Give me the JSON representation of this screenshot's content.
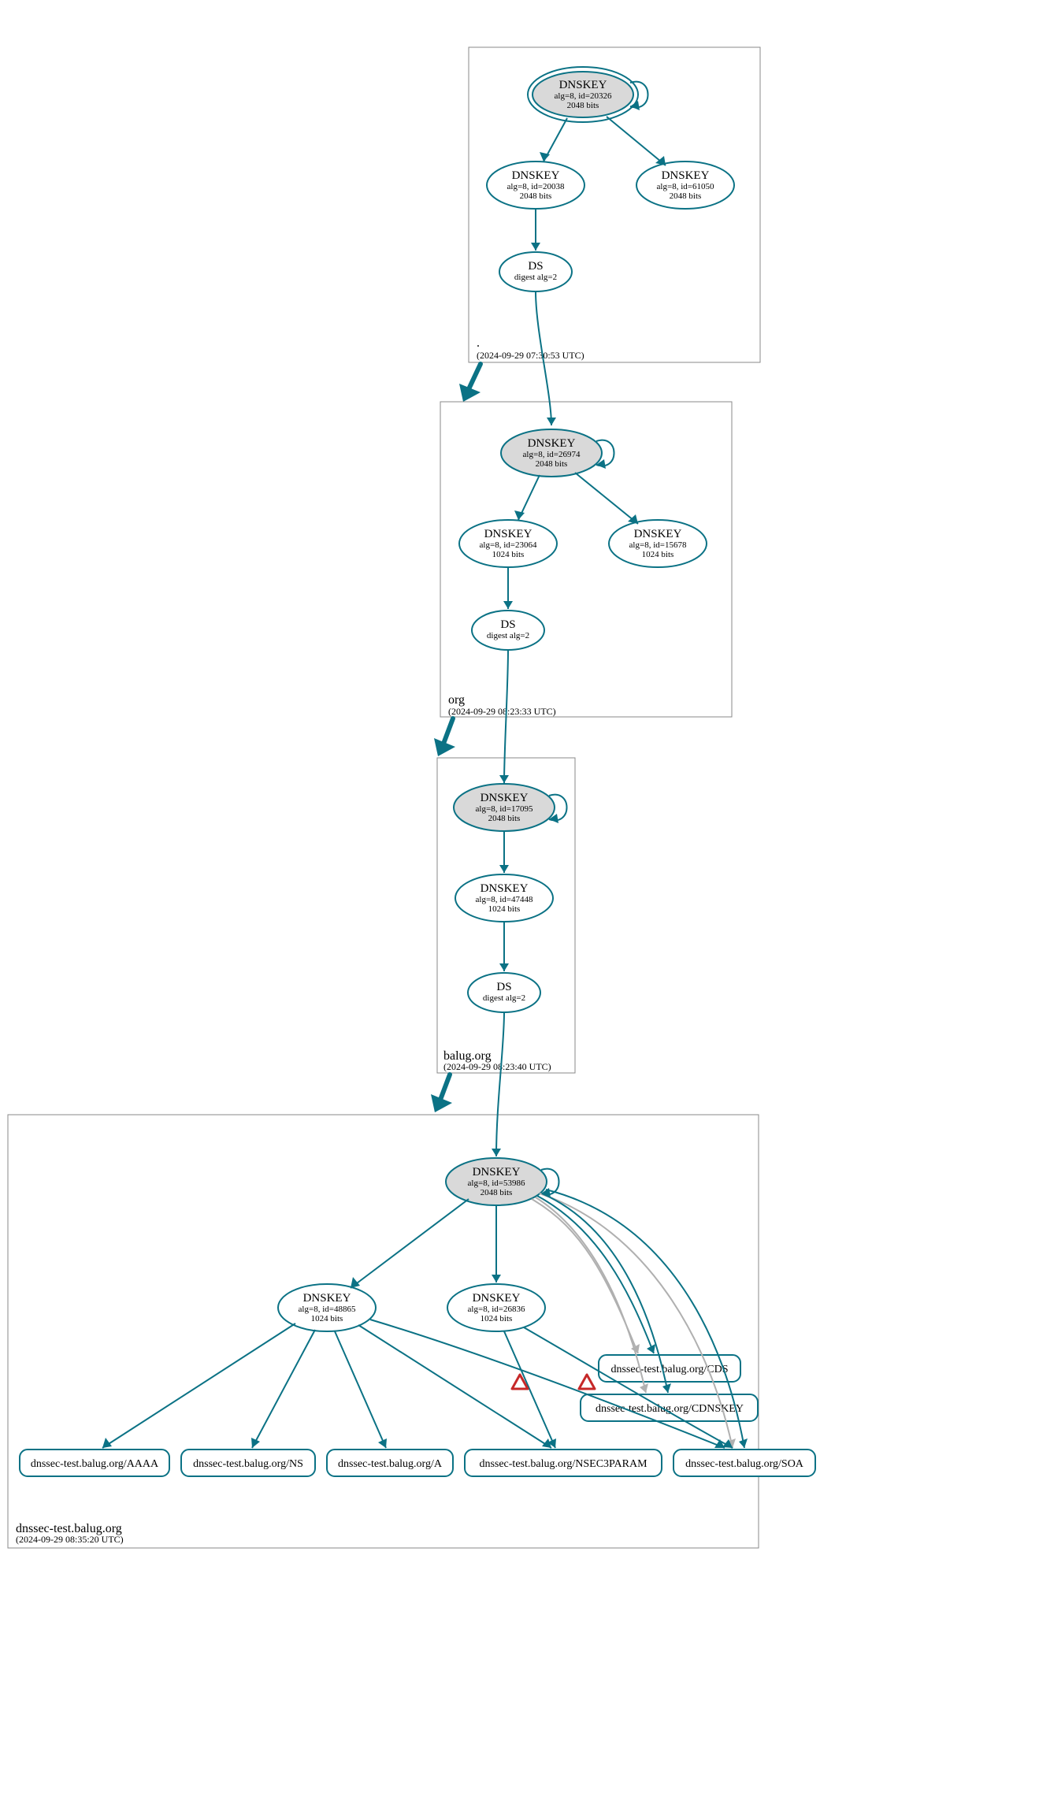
{
  "zones": {
    "root": {
      "label": ".",
      "timestamp": "(2024-09-29 07:30:53 UTC)"
    },
    "org": {
      "label": "org",
      "timestamp": "(2024-09-29 08:23:33 UTC)"
    },
    "balug": {
      "label": "balug.org",
      "timestamp": "(2024-09-29 08:23:40 UTC)"
    },
    "dnssec": {
      "label": "dnssec-test.balug.org",
      "timestamp": "(2024-09-29 08:35:20 UTC)"
    }
  },
  "nodes": {
    "root_ksk": {
      "title": "DNSKEY",
      "line2": "alg=8, id=20326",
      "line3": "2048 bits"
    },
    "root_zsk1": {
      "title": "DNSKEY",
      "line2": "alg=8, id=20038",
      "line3": "2048 bits"
    },
    "root_zsk2": {
      "title": "DNSKEY",
      "line2": "alg=8, id=61050",
      "line3": "2048 bits"
    },
    "root_ds": {
      "title": "DS",
      "line2": "digest alg=2"
    },
    "org_ksk": {
      "title": "DNSKEY",
      "line2": "alg=8, id=26974",
      "line3": "2048 bits"
    },
    "org_zsk1": {
      "title": "DNSKEY",
      "line2": "alg=8, id=23064",
      "line3": "1024 bits"
    },
    "org_zsk2": {
      "title": "DNSKEY",
      "line2": "alg=8, id=15678",
      "line3": "1024 bits"
    },
    "org_ds": {
      "title": "DS",
      "line2": "digest alg=2"
    },
    "balug_ksk": {
      "title": "DNSKEY",
      "line2": "alg=8, id=17095",
      "line3": "2048 bits"
    },
    "balug_zsk": {
      "title": "DNSKEY",
      "line2": "alg=8, id=47448",
      "line3": "1024 bits"
    },
    "balug_ds": {
      "title": "DS",
      "line2": "digest alg=2"
    },
    "dnssec_ksk": {
      "title": "DNSKEY",
      "line2": "alg=8, id=53986",
      "line3": "2048 bits"
    },
    "dnssec_zsk1": {
      "title": "DNSKEY",
      "line2": "alg=8, id=48865",
      "line3": "1024 bits"
    },
    "dnssec_zsk2": {
      "title": "DNSKEY",
      "line2": "alg=8, id=26836",
      "line3": "1024 bits"
    }
  },
  "rr": {
    "aaaa": "dnssec-test.balug.org/AAAA",
    "ns": "dnssec-test.balug.org/NS",
    "a": "dnssec-test.balug.org/A",
    "nsec3": "dnssec-test.balug.org/NSEC3PARAM",
    "soa": "dnssec-test.balug.org/SOA",
    "cds": "dnssec-test.balug.org/CDS",
    "cdnskey": "dnssec-test.balug.org/CDNSKEY"
  },
  "colors": {
    "accent": "#0b7285",
    "ksk_fill": "#d9d9d9",
    "warn": "#c62828",
    "gray_edge": "#b0b0b0"
  }
}
